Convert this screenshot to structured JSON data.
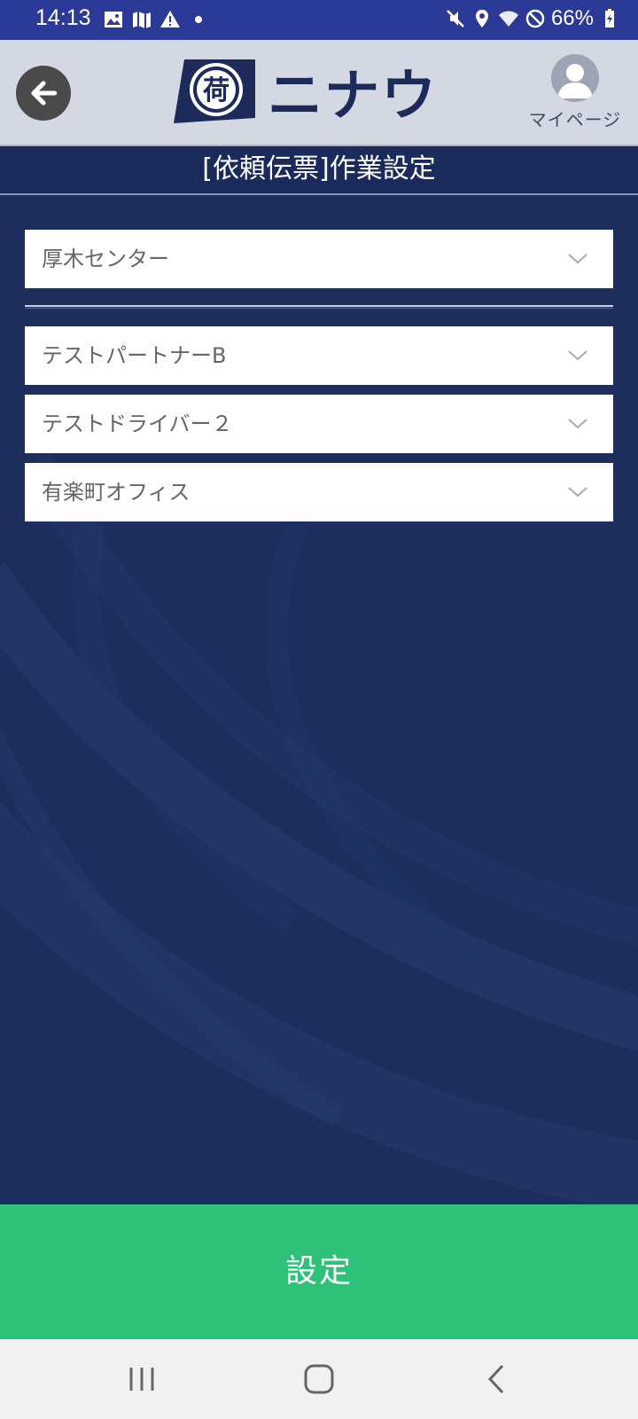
{
  "status_bar": {
    "time": "14:13",
    "battery": "66%",
    "left_icons": [
      "image-icon",
      "map-icon",
      "warning-icon",
      "dot-icon"
    ],
    "right_icons": [
      "mute-icon",
      "location-icon",
      "wifi-icon",
      "do-not-disturb-icon",
      "battery-charging-icon"
    ]
  },
  "header": {
    "back_icon": "arrow-left-icon",
    "logo_text": "ニナウ",
    "logo_mark": "荷",
    "mypage_label": "マイページ",
    "colors": {
      "background": "#d4d8e3",
      "logo": "#1c2b5a"
    }
  },
  "page": {
    "title": "[依頼伝票]作業設定"
  },
  "form": {
    "center_select": "厚木センター",
    "partner_select": "テストパートナーB",
    "driver_select": "テストドライバー２",
    "office_select": "有楽町オフィス"
  },
  "actions": {
    "submit_label": "設定",
    "submit_color": "#2dc277"
  },
  "nav_bar": {
    "recent_icon": "recent-apps-icon",
    "home_icon": "home-icon",
    "back_icon": "back-chevron-icon"
  }
}
